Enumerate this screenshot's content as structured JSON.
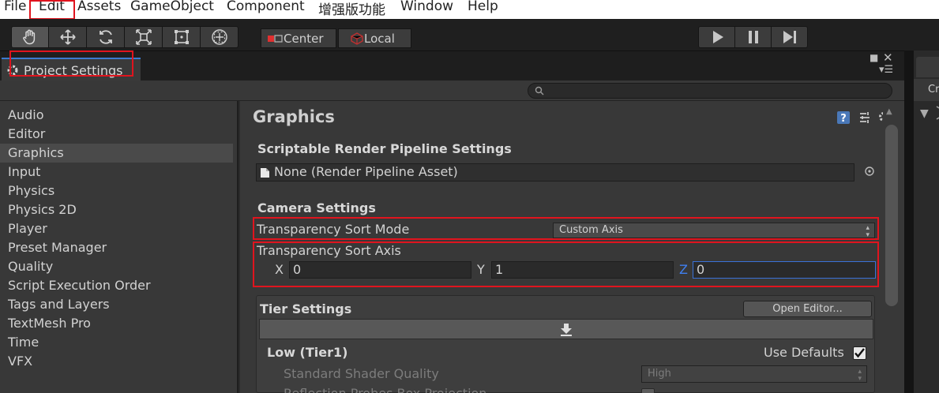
{
  "menubar": {
    "items": [
      "File",
      "Edit",
      "Assets",
      "GameObject",
      "Component",
      "增强版功能",
      "Window",
      "Help"
    ]
  },
  "toolbar": {
    "tools": [
      "hand-icon",
      "move-icon",
      "rotate-icon",
      "scale-icon",
      "rect-icon",
      "transform-icon"
    ],
    "pivot_label": "Center",
    "space_label": "Local",
    "playback": [
      "play-icon",
      "pause-icon",
      "step-icon"
    ]
  },
  "window": {
    "tab_title": "Project Settings",
    "right_panel_label": "Cr"
  },
  "sidebar": {
    "items": [
      "Audio",
      "Editor",
      "Graphics",
      "Input",
      "Physics",
      "Physics 2D",
      "Player",
      "Preset Manager",
      "Quality",
      "Script Execution Order",
      "Tags and Layers",
      "TextMesh Pro",
      "Time",
      "VFX"
    ],
    "selected": "Graphics"
  },
  "graphics": {
    "title": "Graphics",
    "srp_heading": "Scriptable Render Pipeline Settings",
    "srp_value": "None (Render Pipeline Asset)",
    "camera_heading": "Camera Settings",
    "sort_mode_label": "Transparency Sort Mode",
    "sort_mode_value": "Custom Axis",
    "sort_axis_label": "Transparency Sort Axis",
    "axis": {
      "x_label": "X",
      "x_value": "0",
      "y_label": "Y",
      "y_value": "1",
      "z_label": "Z",
      "z_value": "0"
    },
    "tier_heading": "Tier Settings",
    "open_editor_label": "Open Editor...",
    "tier_name": "Low (Tier1)",
    "use_defaults_label": "Use Defaults",
    "use_defaults_checked": true,
    "shader_quality_label": "Standard Shader Quality",
    "shader_quality_value": "High",
    "reflection_label": "Reflection Probes Box Projection"
  },
  "colors": {
    "highlight_red": "#e0141e",
    "selection_blue": "#3b7ad0",
    "z_label_blue": "#3f7ff0"
  }
}
